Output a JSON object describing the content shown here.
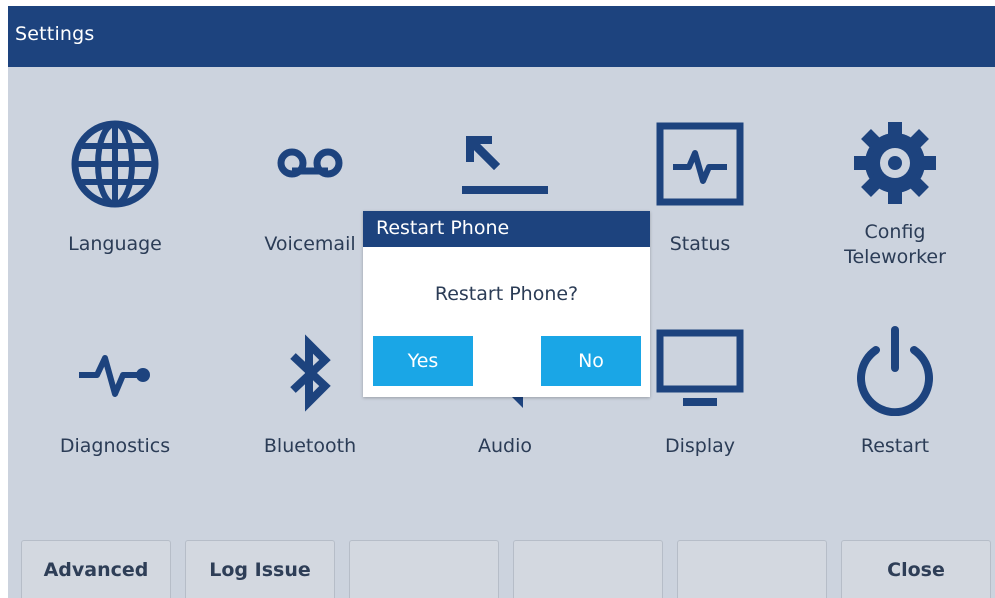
{
  "window": {
    "title": "Settings"
  },
  "tiles": [
    {
      "label": "Language",
      "icon": "globe-icon"
    },
    {
      "label": "Voicemail",
      "icon": "voicemail-icon"
    },
    {
      "label": "",
      "icon": "incoming-arrows-icon"
    },
    {
      "label": "Status",
      "icon": "status-monitor-icon"
    },
    {
      "label": "Config\nTeleworker",
      "icon": "gear-icon"
    },
    {
      "label": "Diagnostics",
      "icon": "pulse-icon"
    },
    {
      "label": "Bluetooth",
      "icon": "bluetooth-icon"
    },
    {
      "label": "Audio",
      "icon": "audio-icon"
    },
    {
      "label": "Display",
      "icon": "monitor-icon"
    },
    {
      "label": "Restart",
      "icon": "power-icon"
    }
  ],
  "softkeys": [
    "Advanced",
    "Log Issue",
    "",
    "",
    "",
    "Close"
  ],
  "dialog": {
    "title": "Restart Phone",
    "message": "Restart Phone?",
    "yes_label": "Yes",
    "no_label": "No"
  },
  "colors": {
    "header": "#1d437e",
    "icon": "#1d437e",
    "background": "#ccd3de",
    "dialog_button": "#1aa6e6"
  }
}
